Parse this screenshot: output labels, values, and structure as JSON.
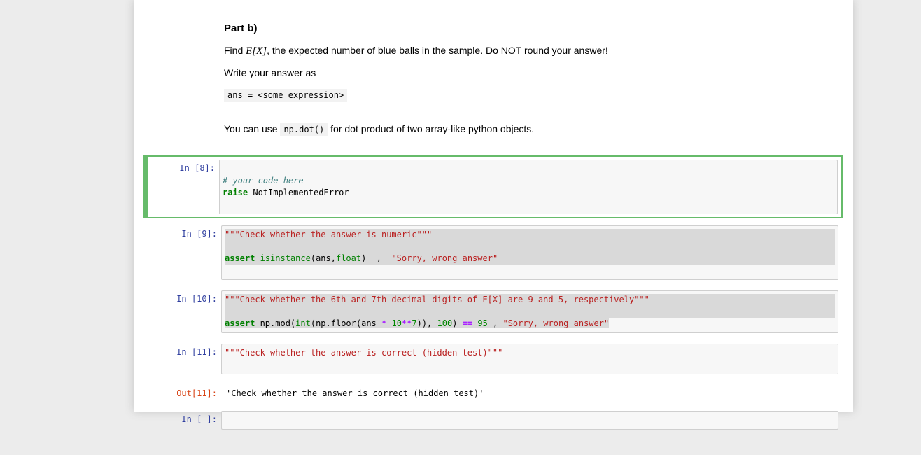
{
  "colors": {
    "page_background": "#ececec",
    "notebook_background": "#ffffff",
    "selected_cell_border": "#66bb6a",
    "input_background": "#f7f7f7",
    "selection_highlight": "#d9d9d9",
    "in_prompt": "#303F9F",
    "out_prompt": "#D84315",
    "syntax_keyword": "#008000",
    "syntax_string": "#BA2121",
    "syntax_comment": "#408080",
    "syntax_number": "#008800",
    "syntax_operator": "#AA22FF"
  },
  "markdown": {
    "heading": "Part b)",
    "p1_pre": "Find ",
    "p1_math": "E[X]",
    "p1_post": ", the expected number of blue balls in the sample. Do NOT round your answer!",
    "p2": "Write your answer as",
    "code1": "ans = <some expression>",
    "p3_pre": "You can use ",
    "p3_code": "np.dot()",
    "p3_post": " for dot product of two array-like python objects."
  },
  "cells": {
    "in8": {
      "prompt": "In [8]:",
      "comment": "# your code here",
      "kw_raise": "raise",
      "exc": " NotImplementedError"
    },
    "in9": {
      "prompt": "In [9]:",
      "docstring": "\"\"\"Check whether the answer is numeric\"\"\"",
      "kw_assert": "assert",
      "t1": " ",
      "b_isinstance": "isinstance",
      "t2": "(ans,",
      "b_float": "float",
      "t3": ")  ,  ",
      "str_msg": "\"Sorry, wrong answer\""
    },
    "in10": {
      "prompt": "In [10]:",
      "docstring": "\"\"\"Check whether the 6th and 7th decimal digits of E[X] are 9 and 5, respectively\"\"\"",
      "kw_assert": "assert",
      "t1": " np.mod(",
      "b_int": "int",
      "t2": "(np.floor(ans ",
      "op1": "*",
      "t3": " ",
      "n1": "10",
      "op2": "**",
      "n2": "7",
      "t4": ")), ",
      "n3": "100",
      "t5": ") ",
      "op3": "==",
      "t6": " ",
      "n4": "95",
      "t7": " , ",
      "str_msg": "\"Sorry, wrong answer\""
    },
    "in11": {
      "prompt": "In [11]:",
      "docstring": "\"\"\"Check whether the answer is correct (hidden test)\"\"\""
    },
    "out11": {
      "prompt": "Out[11]:",
      "text": "'Check whether the answer is correct (hidden test)'"
    },
    "in_empty": {
      "prompt": "In [ ]:"
    }
  }
}
